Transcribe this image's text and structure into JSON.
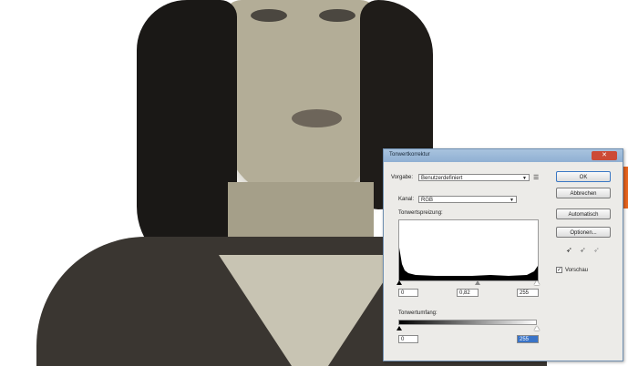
{
  "dialog": {
    "title": "Tonwertkorrektur",
    "preset_label": "Vorgabe:",
    "preset_value": "Benutzerdefiniert",
    "channel_label": "Kanal:",
    "channel_value": "RGB",
    "input_levels_label": "Tonwertspreizung:",
    "input_black": "0",
    "input_gamma": "0,82",
    "input_white": "255",
    "output_levels_label": "Tonwertumfang:",
    "output_black": "0",
    "output_white": "255",
    "ok_label": "OK",
    "cancel_label": "Abbrechen",
    "auto_label": "Automatisch",
    "options_label": "Optionen...",
    "preview_label": "Vorschau",
    "preview_checked": true
  },
  "colors": {
    "accent_tab": "#e8641e",
    "titlebar": "#9bb8d8",
    "close_button": "#cc4a36"
  }
}
